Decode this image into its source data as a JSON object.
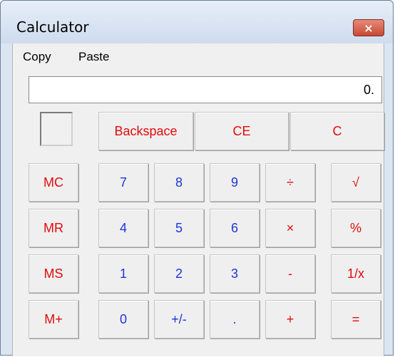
{
  "window": {
    "title": "Calculator",
    "close_icon": "×"
  },
  "menu": {
    "copy": "Copy",
    "paste": "Paste"
  },
  "display": {
    "value": "0."
  },
  "buttons": {
    "backspace": "Backspace",
    "ce": "CE",
    "c": "C",
    "mc": "MC",
    "mr": "MR",
    "ms": "MS",
    "mplus": "M+",
    "seven": "7",
    "eight": "8",
    "nine": "9",
    "divide": "÷",
    "sqrt": "√",
    "four": "4",
    "five": "5",
    "six": "6",
    "multiply": "×",
    "percent": "%",
    "one": "1",
    "two": "2",
    "three": "3",
    "minus": "-",
    "reciprocal": "1/x",
    "zero": "0",
    "plusminus": "+/-",
    "decimal": ".",
    "plus": "+",
    "equals": "="
  },
  "colors": {
    "red_label": "#e10b0b",
    "blue_label": "#1f35d8"
  }
}
